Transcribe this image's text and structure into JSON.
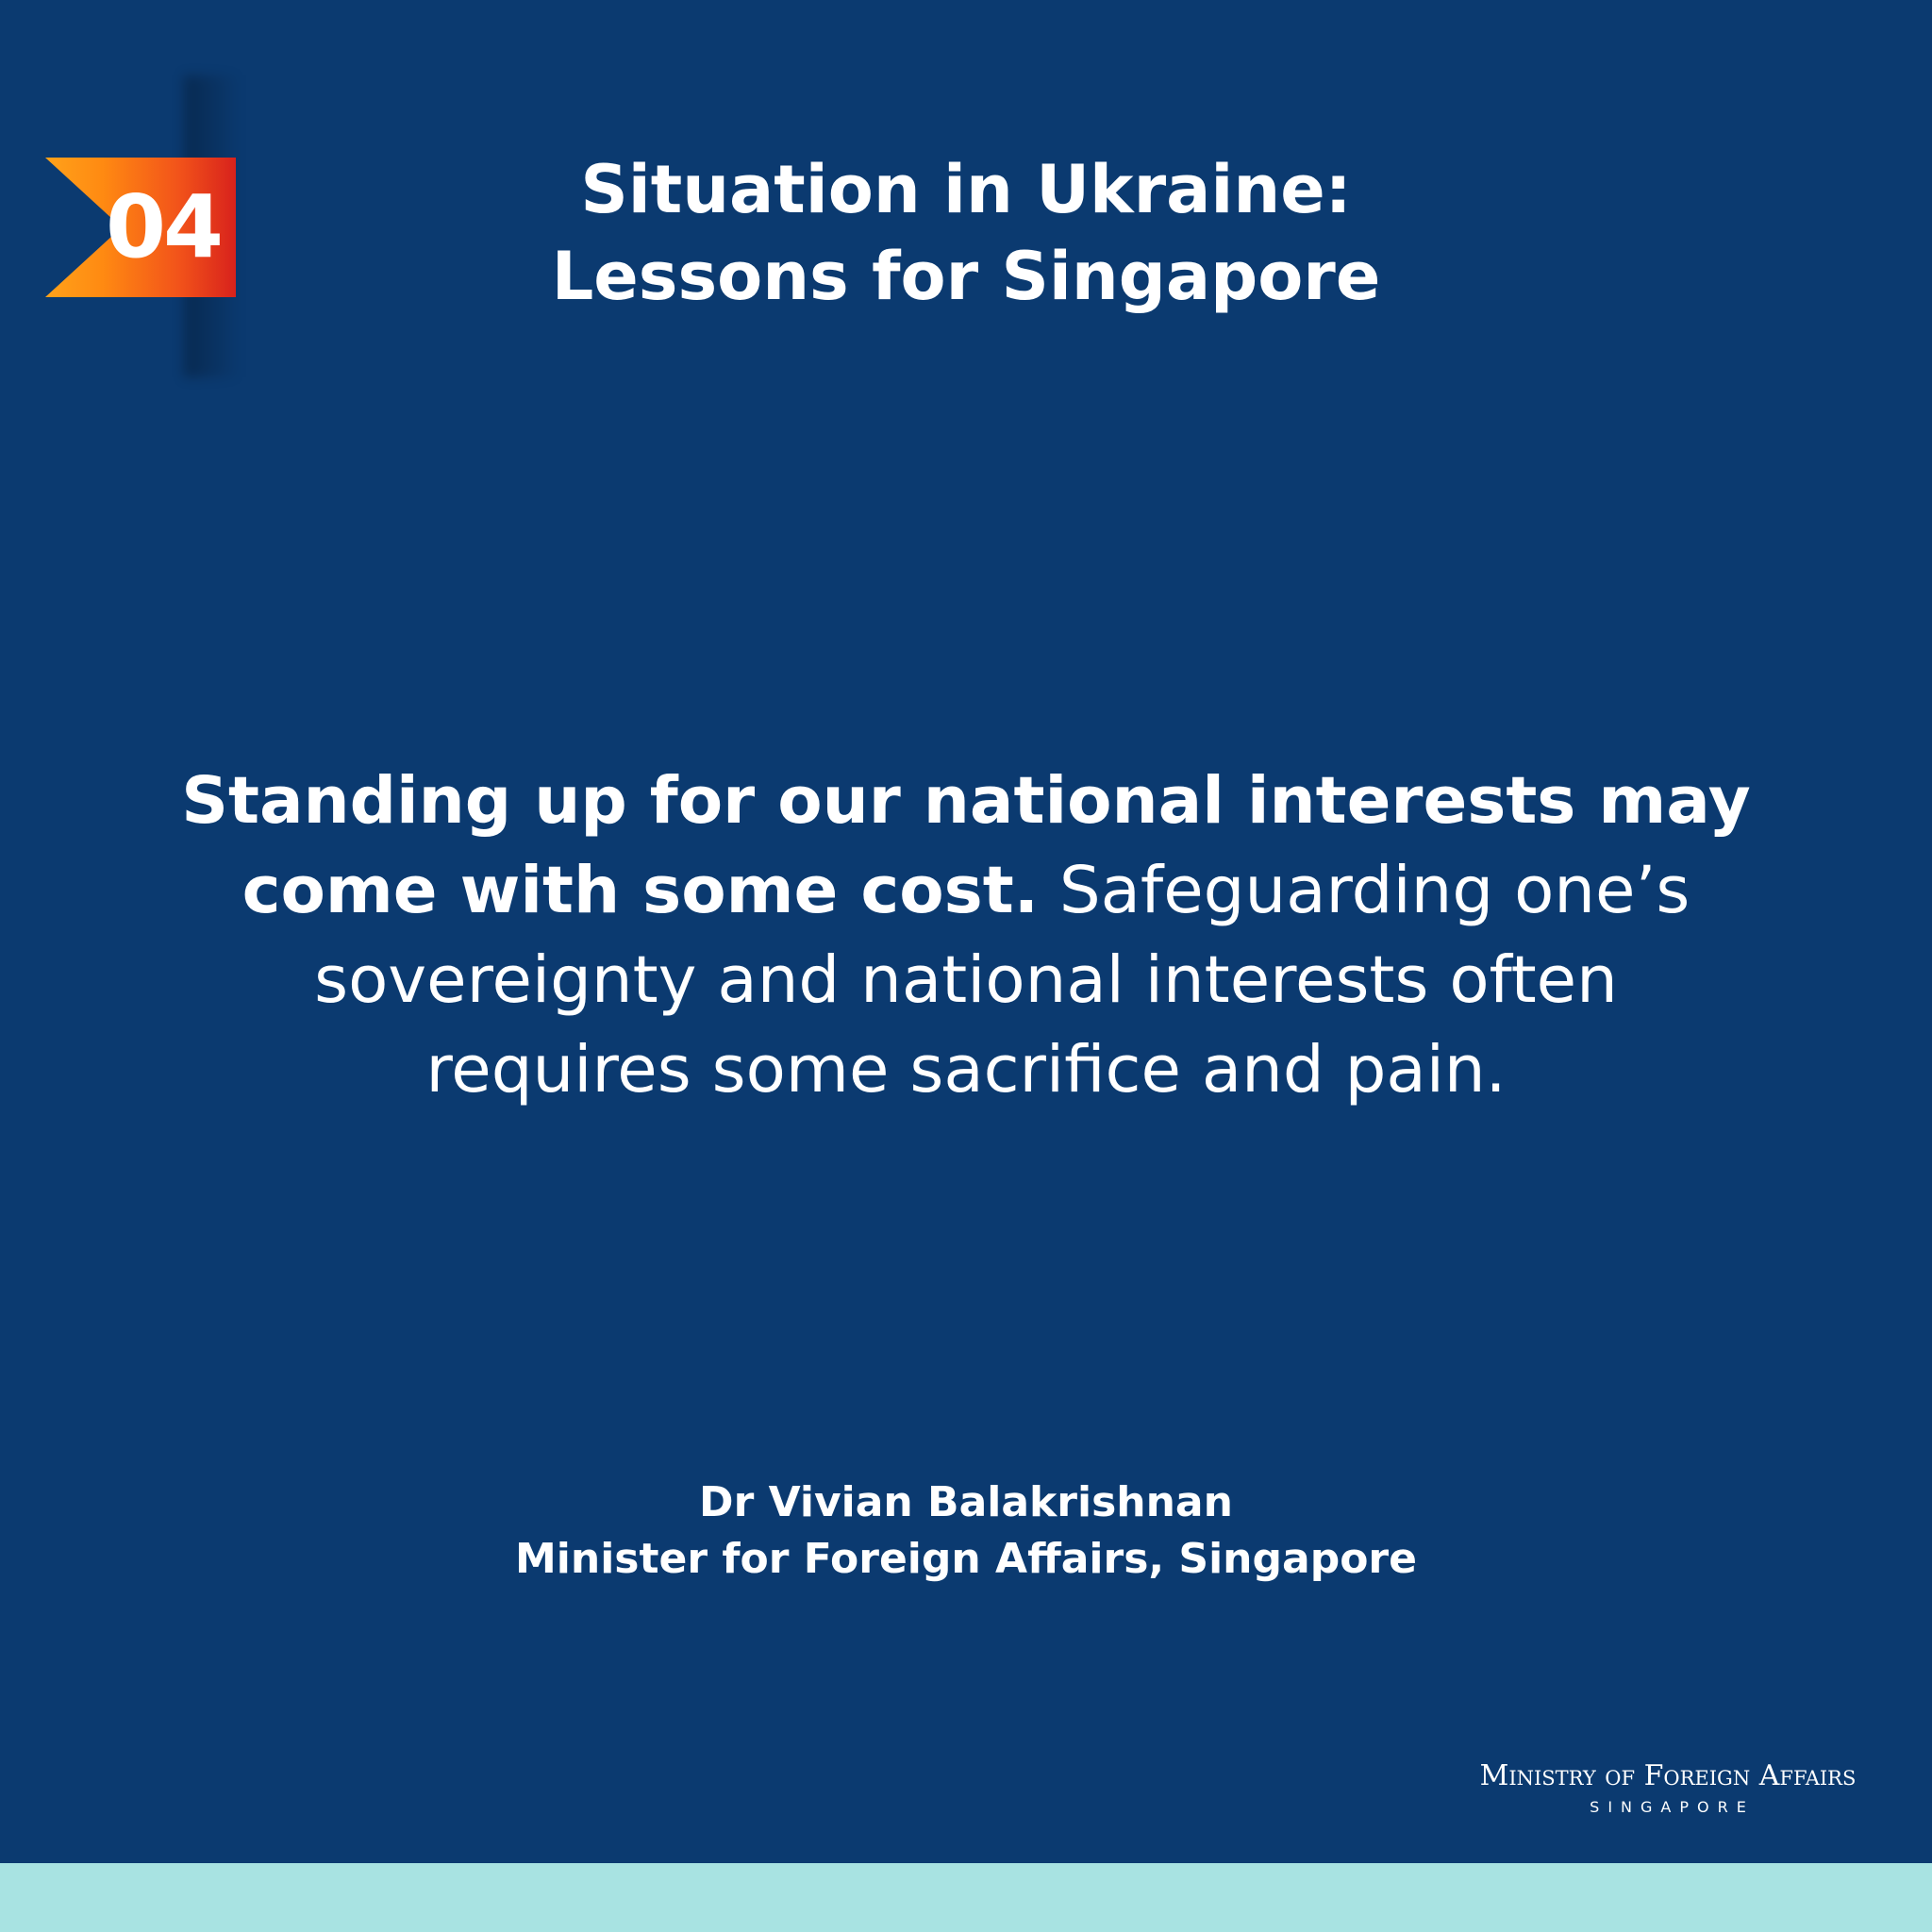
{
  "badge": {
    "number": "04"
  },
  "header": {
    "title_line1": "Situation in Ukraine:",
    "title_line2": "Lessons for Singapore"
  },
  "quote": {
    "line1_bold": "Standing up for our national interests may",
    "line2_bold": "come with some cost.",
    "line2_regular": " Safeguarding one’s",
    "line3": "sovereignty and national interests often",
    "line4": "requires some sacrifice and pain."
  },
  "attribution": {
    "name": "Dr Vivian Balakrishnan",
    "role": "Minister for Foreign Affairs, Singapore"
  },
  "logo": {
    "main": "Ministry of Foreign Affairs",
    "sub": "SINGAPORE"
  },
  "colors": {
    "background": "#0b3a70",
    "badge_start": "#ffa21a",
    "badge_end": "#d8221c",
    "bottom_bar": "#a8e3e2",
    "text": "#ffffff"
  }
}
